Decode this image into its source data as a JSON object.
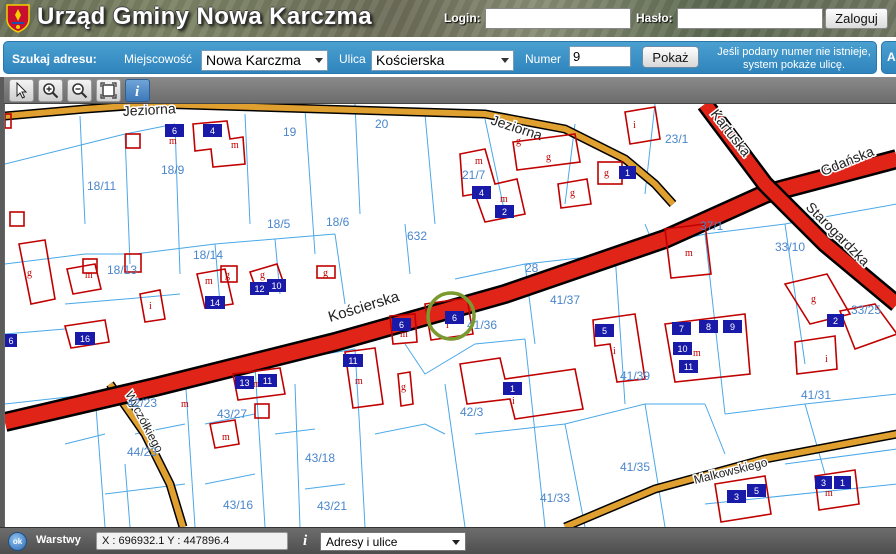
{
  "header": {
    "title": "Urząd Gminy Nowa Karczma",
    "login_label": "Login:",
    "password_label": "Hasło:",
    "login_value": "",
    "password_value": "",
    "login_button": "Zaloguj"
  },
  "search": {
    "heading": "Szukaj adresu:",
    "locality_label": "Miejscowość",
    "locality_value": "Nowa Karczma",
    "street_label": "Ulica",
    "street_value": "Kościerska",
    "number_label": "Numer",
    "number_value": "9",
    "show_button": "Pokaż",
    "note": "Jeśli podany numer nie istnieje, system pokaże ulicę.",
    "right_panel_label": "A"
  },
  "toolbar": {
    "tools": [
      {
        "name": "select-arrow-icon",
        "active": false
      },
      {
        "name": "zoom-in-icon",
        "active": false
      },
      {
        "name": "zoom-out-icon",
        "active": false
      },
      {
        "name": "full-extent-icon",
        "active": false
      },
      {
        "name": "info-icon",
        "active": true
      }
    ]
  },
  "map": {
    "streets": [
      "Kościerska",
      "Jeziorna",
      "Kartuska",
      "Gdańska",
      "Starogardzka",
      "Wyczółkiego",
      "Malkowskiego"
    ],
    "parcels": [
      "19",
      "20",
      "23/1",
      "18/11",
      "18/9",
      "21/7",
      "18/5",
      "18/6",
      "632",
      "37/1",
      "33/10",
      "18/14",
      "18/13",
      "28",
      "41/37",
      "33/25",
      "41/36",
      "41/39",
      "43/27",
      "41/31",
      "42/3",
      "44/23",
      "43/18",
      "41/35",
      "43/16",
      "43/21",
      "41/33",
      "42/23"
    ],
    "building_numbers": [
      "6",
      "4",
      "2",
      "1",
      "14",
      "12",
      "10",
      "16",
      "6",
      "6",
      "11",
      "13",
      "5",
      "1",
      "7",
      "8",
      "9",
      "10",
      "11",
      "2",
      "3",
      "4",
      "5",
      "3",
      "1",
      "1"
    ],
    "building_glyphs": [
      "m",
      "g",
      "i"
    ],
    "colors": {
      "main_road": "#e02418",
      "road_outline": "#000000",
      "side_road": "#e0a030",
      "parcel_line": "#4aa8e8",
      "building_outline": "#c00000",
      "address_badge": "#1a1aa8",
      "highlight_circle": "#7a9a30",
      "parcel_label": "#4a86cc"
    }
  },
  "status": {
    "ok_label": "ok",
    "layers_label": "Warstwy",
    "coordinates": "X : 696932.1  Y : 447896.4",
    "info_icon": "i",
    "layer_select_value": "Adresy i ulice"
  }
}
